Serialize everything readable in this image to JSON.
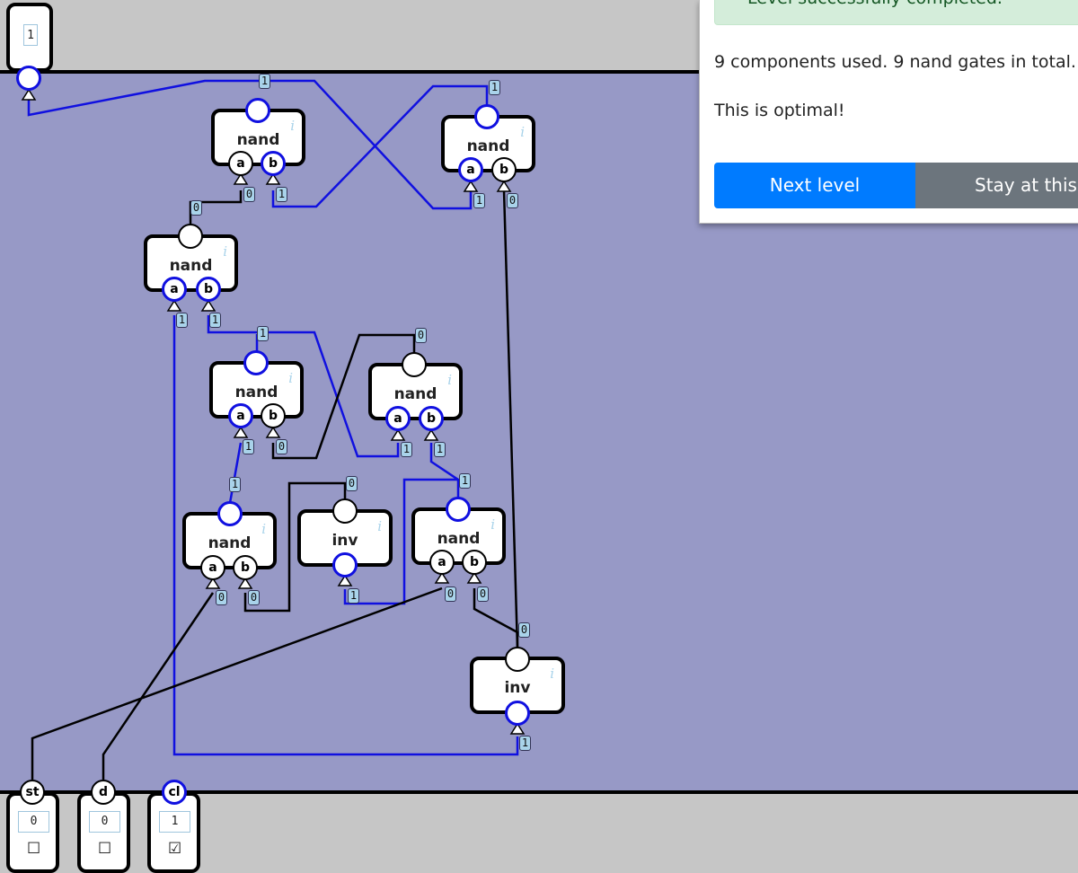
{
  "output_pin": {
    "value": "1"
  },
  "gates": [
    {
      "name": "nand",
      "info": "i"
    },
    {
      "name": "nand",
      "info": "i"
    },
    {
      "name": "nand",
      "info": "i"
    },
    {
      "name": "nand",
      "info": "i"
    },
    {
      "name": "nand",
      "info": "i"
    },
    {
      "name": "nand",
      "info": "i"
    },
    {
      "name": "inv",
      "info": "i"
    },
    {
      "name": "nand",
      "info": "i"
    },
    {
      "name": "inv",
      "info": "i"
    }
  ],
  "pin_labels": {
    "a": "a",
    "b": "b"
  },
  "wire_values": [
    "1",
    "1",
    "0",
    "1",
    "1",
    "0",
    "0",
    "1",
    "1",
    "1",
    "0",
    "0",
    "1",
    "1",
    "1",
    "1",
    "0",
    "1",
    "0",
    "0",
    "0",
    "0",
    "0",
    "1"
  ],
  "inputs": [
    {
      "name": "st",
      "value": "0",
      "checkbox": "☐"
    },
    {
      "name": "d",
      "value": "0",
      "checkbox": "☐"
    },
    {
      "name": "cl",
      "value": "1",
      "checkbox": "☑"
    }
  ],
  "panel": {
    "status": "Level successfully completed.",
    "components_text": "9 components used. 9 nand gates in total.",
    "optimal_text": "This is optimal!",
    "next_button": "Next level",
    "stay_button": "Stay at this level"
  },
  "colors": {
    "canvas": "#9799c6",
    "background": "#c6c6c6",
    "wire_on": "#1010e0",
    "wire_off": "#000000",
    "primary": "#007bff",
    "secondary": "#6c757d",
    "success_bg": "#d4edda",
    "success_text": "#155724"
  }
}
